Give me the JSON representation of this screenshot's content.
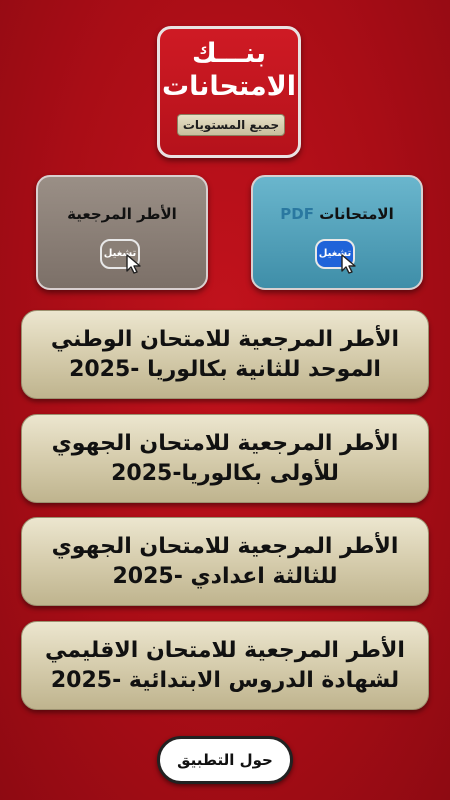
{
  "logo": {
    "line1": "بنـــك",
    "line2": "الامتحانات",
    "badge": "جميع المستويات"
  },
  "cards": {
    "left": {
      "title": "الأطر المرجعية",
      "play_label": "تشغيل"
    },
    "right": {
      "title_main": "الامتحانات",
      "title_pdf": "PDF",
      "play_label": "تشغيل"
    }
  },
  "items": [
    {
      "line1": "الأطر المرجعية للامتحان الوطني",
      "line2": "الموحد للثانية  بكالوريا -2025"
    },
    {
      "line1": "الأطر المرجعية للامتحان الجهوي",
      "line2": "للأولى بكالوريا-2025"
    },
    {
      "line1": "الأطر المرجعية للامتحان الجهوي",
      "line2": "للثالثة اعدادي -2025"
    },
    {
      "line1": "الأطر المرجعية للامتحان الاقليمي",
      "line2": "لشهادة الدروس الابتدائية -2025"
    }
  ],
  "about_button": "حول التطبيق",
  "colors": {
    "background": "#b5121b",
    "item_gold": "#d8cfb0",
    "card_left": "#8a7f76",
    "card_right": "#4f9db7"
  },
  "icons": [
    "cursor-pointer-icon"
  ]
}
